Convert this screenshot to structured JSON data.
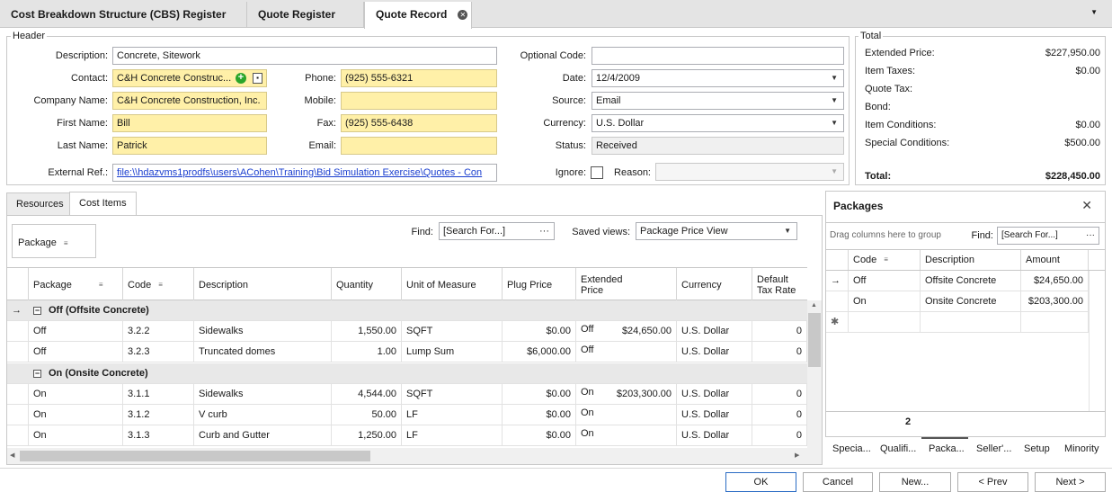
{
  "tabs": [
    {
      "label": "Cost Breakdown Structure (CBS) Register"
    },
    {
      "label": "Quote Register"
    },
    {
      "label": "Quote Record"
    }
  ],
  "header": {
    "group_label": "Header",
    "description": {
      "label": "Description:",
      "value": "Concrete, Sitework"
    },
    "contact": {
      "label": "Contact:",
      "value": "C&H Concrete Construc..."
    },
    "company": {
      "label": "Company Name:",
      "value": "C&H Concrete Construction, Inc."
    },
    "first_name": {
      "label": "First Name:",
      "value": "Bill"
    },
    "last_name": {
      "label": "Last Name:",
      "value": "Patrick"
    },
    "external_ref": {
      "label": "External Ref.:",
      "value": "file:\\\\hdazvms1prodfs\\users\\ACohen\\Training\\Bid Simulation Exercise\\Quotes - Con"
    },
    "phone": {
      "label": "Phone:",
      "value": "(925) 555-6321"
    },
    "mobile": {
      "label": "Mobile:",
      "value": ""
    },
    "fax": {
      "label": "Fax:",
      "value": "(925) 555-6438"
    },
    "email": {
      "label": "Email:",
      "value": ""
    },
    "optional_code": {
      "label": "Optional Code:",
      "value": ""
    },
    "date": {
      "label": "Date:",
      "value": "12/4/2009"
    },
    "source": {
      "label": "Source:",
      "value": "Email"
    },
    "currency": {
      "label": "Currency:",
      "value": "U.S. Dollar"
    },
    "status": {
      "label": "Status:",
      "value": "Received"
    },
    "ignore": {
      "label": "Ignore:"
    },
    "reason": {
      "label": "Reason:",
      "value": ""
    }
  },
  "total": {
    "group_label": "Total",
    "rows": [
      {
        "label": "Extended Price:",
        "value": "$227,950.00"
      },
      {
        "label": "Item Taxes:",
        "value": "$0.00"
      },
      {
        "label": "Quote Tax:",
        "value": ""
      },
      {
        "label": "Bond:",
        "value": ""
      },
      {
        "label": "Item Conditions:",
        "value": "$0.00"
      },
      {
        "label": "Special Conditions:",
        "value": "$500.00"
      }
    ],
    "total_label": "Total:",
    "total_value": "$228,450.00"
  },
  "subtabs": [
    {
      "label": "Resources"
    },
    {
      "label": "Cost Items"
    }
  ],
  "grid": {
    "group_by": "Package",
    "find_label": "Find:",
    "find_placeholder": "[Search For...]",
    "saved_views_label": "Saved views:",
    "saved_view": "Package Price View",
    "columns": [
      "Package",
      "Code",
      "Description",
      "Quantity",
      "Unit of Measure",
      "Plug Price",
      "Extended Price",
      "Currency",
      "Default Tax Rate"
    ],
    "groups": [
      {
        "label": "Off (Offsite Concrete)",
        "rows": [
          {
            "package": "Off",
            "code": "3.2.2",
            "description": "Sidewalks",
            "quantity": "1,550.00",
            "uom": "SQFT",
            "plug": "$0.00",
            "ext_pkg": "Off",
            "ext": "$24,650.00",
            "currency": "U.S. Dollar",
            "tax": "0"
          },
          {
            "package": "Off",
            "code": "3.2.3",
            "description": "Truncated domes",
            "quantity": "1.00",
            "uom": "Lump Sum",
            "plug": "$6,000.00",
            "ext_pkg": "Off",
            "ext": "",
            "currency": "U.S. Dollar",
            "tax": "0"
          }
        ]
      },
      {
        "label": "On (Onsite Concrete)",
        "rows": [
          {
            "package": "On",
            "code": "3.1.1",
            "description": "Sidewalks",
            "quantity": "4,544.00",
            "uom": "SQFT",
            "plug": "$0.00",
            "ext_pkg": "On",
            "ext": "$203,300.00",
            "currency": "U.S. Dollar",
            "tax": "0"
          },
          {
            "package": "On",
            "code": "3.1.2",
            "description": "V curb",
            "quantity": "50.00",
            "uom": "LF",
            "plug": "$0.00",
            "ext_pkg": "On",
            "ext": "",
            "currency": "U.S. Dollar",
            "tax": "0"
          },
          {
            "package": "On",
            "code": "3.1.3",
            "description": "Curb and Gutter",
            "quantity": "1,250.00",
            "uom": "LF",
            "plug": "$0.00",
            "ext_pkg": "On",
            "ext": "",
            "currency": "U.S. Dollar",
            "tax": "0"
          }
        ]
      }
    ]
  },
  "packages": {
    "title": "Packages",
    "drag_hint": "Drag columns here to group",
    "find_label": "Find:",
    "find_placeholder": "[Search For...]",
    "columns": [
      "Code",
      "Description",
      "Amount"
    ],
    "rows": [
      {
        "code": "Off",
        "description": "Offsite Concrete",
        "amount": "$24,650.00"
      },
      {
        "code": "On",
        "description": "Onsite Concrete",
        "amount": "$203,300.00"
      }
    ],
    "count": "2",
    "side_tabs": [
      "Specia...",
      "Qualifi...",
      "Packa...",
      "Seller'...",
      "Setup",
      "Minority"
    ]
  },
  "buttons": {
    "ok": "OK",
    "cancel": "Cancel",
    "new": "New...",
    "prev": "< Prev",
    "next": "Next >"
  }
}
